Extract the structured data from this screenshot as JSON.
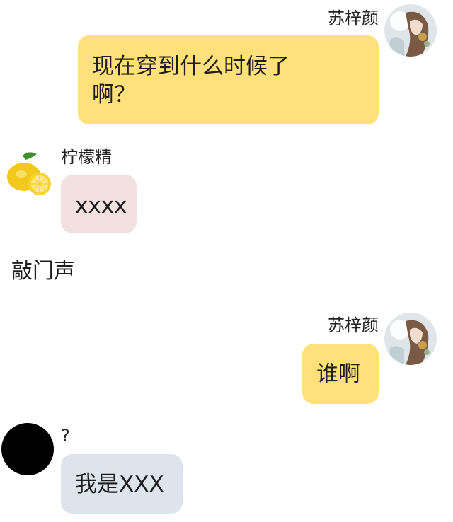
{
  "messages": [
    {
      "sender": "苏梓颜",
      "text": "现在穿到什么时候了啊？",
      "line1": "现在穿到什么时候了",
      "line2": "啊？"
    },
    {
      "sender": "柠檬精",
      "text": "xxxx"
    },
    {
      "narration": "敲门声"
    },
    {
      "sender": "苏梓颜",
      "text": "谁啊"
    },
    {
      "sender": "?",
      "text": "我是XXX"
    }
  ],
  "colors": {
    "self_bubble": "#ffe07a",
    "lemon_bubble": "#f3e1e1",
    "unknown_bubble": "#dde4ec",
    "unknown_avatar": "#000000"
  },
  "icons": {
    "self_avatar": "girl-illustration-avatar",
    "lemon_avatar": "lemon-icon",
    "unknown_avatar": "black-circle-avatar"
  }
}
